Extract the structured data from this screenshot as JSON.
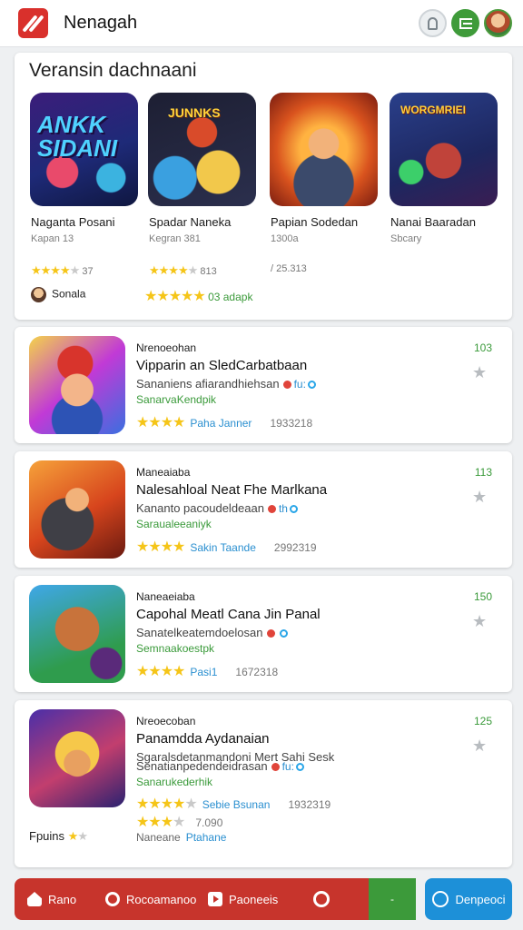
{
  "header": {
    "title": "Nenagah"
  },
  "featured": {
    "title": "Veransin dachnaani",
    "tiles": [
      {
        "name": "Naganta Posani",
        "sub": "Kapan 13",
        "rating_count": "37",
        "stars": 4.5,
        "art_text": "ANKK SIDANI"
      },
      {
        "name": "Spadar Naneka",
        "sub": "Kegran 381",
        "rating_count": "813",
        "stars": 4,
        "art_text": "JUNNKS"
      },
      {
        "name": "Papian Sodedan",
        "sub": "1300a",
        "rating_count": "/ 25.313",
        "stars": 0
      },
      {
        "name": "Nanai Baaradan",
        "sub": "Sbcary",
        "art_text": "WORGMRIEI"
      }
    ],
    "author": "Sonala",
    "bottom_stars": 5,
    "bottom_text": "03 adapk"
  },
  "list": [
    {
      "category": "Nrenoeohan",
      "name": "Vipparin an SledCarbatbaan",
      "developer": "Sananiens afiarandhiehsan",
      "badge_text": "fu:",
      "genre": "SanarvaKendpik",
      "stars": 4,
      "rating_label": "Paha Janner",
      "count": "1933218",
      "price": "103"
    },
    {
      "category": "Maneaiaba",
      "name": "Nalesahloal Neat Fhe Marlkana",
      "developer": "Kananto pacoudeldeaan",
      "badge_text": "th",
      "genre": "Saraualeeaniyk",
      "stars": 4,
      "rating_label": "Sakin Taande",
      "count": "2992319",
      "price": "113"
    },
    {
      "category": "Naneaeiaba",
      "name": "Capohal Meatl Cana Jin Panal",
      "developer": "Sanatelkeatemdoelosan",
      "badge_text": "",
      "genre": "Semnaakoestpk",
      "stars": 4,
      "rating_label": "Pasi1",
      "count": "1672318",
      "price": "150"
    },
    {
      "category": "Nreoecoban",
      "name": "Panamdda Aydanaian",
      "developer": "Sgaralsdetanmandoni Mert Sahi Sesk",
      "developer2": "Senatianpedendeidrasan",
      "badge_text": "fu:",
      "genre": "Sanarukederhik",
      "stars": 3.5,
      "rating_label": "Sebie Bsunan",
      "count": "1932319",
      "stars2": 3,
      "count2": "7.090",
      "foot_label": "Fpuins",
      "foot_stars": 1,
      "foot_left": "Naneane",
      "foot_link": "Ptahane",
      "price": "125"
    }
  ],
  "bottom_nav": {
    "home": "Rano",
    "recommended": "Rocoamanoo",
    "premium": "Paoneeis",
    "center": "-",
    "connect": "Denpeoci"
  },
  "colors": {
    "accent_red": "#c7342c",
    "accent_green": "#3c9a3a",
    "accent_blue": "#1d90d8",
    "star": "#f5c518"
  }
}
